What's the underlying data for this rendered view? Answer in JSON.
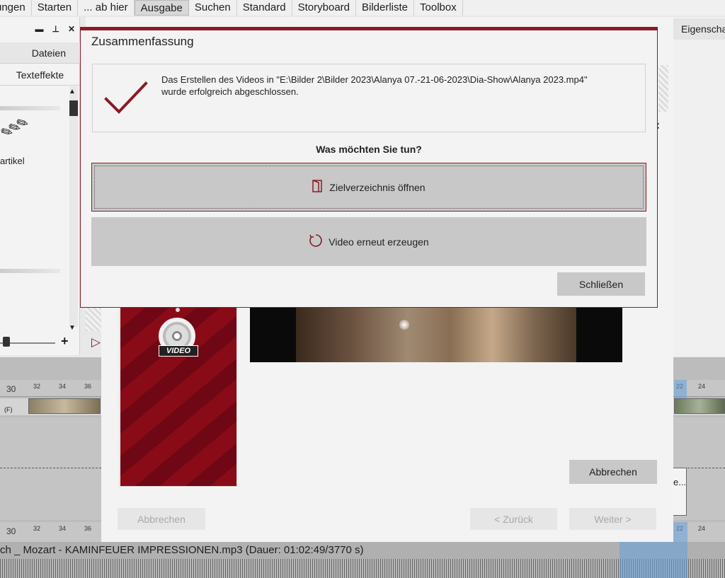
{
  "menu": {
    "items": [
      "ungen",
      "Starten",
      "... ab hier",
      "Ausgabe",
      "Suchen",
      "Standard",
      "Storyboard",
      "Bilderliste",
      "Toolbox"
    ],
    "active_index": 3
  },
  "left_panel": {
    "tab_dateien": "Dateien",
    "tab_texteffekte": "Texteffekte",
    "item_label": "artikel",
    "btn_minimize": "▬",
    "btn_pin": "📌",
    "btn_close": "✕",
    "add_icon": "+"
  },
  "right_panel": {
    "title": "Eigenschaften"
  },
  "timeline": {
    "ruler_top": [
      "30",
      "32",
      "34",
      "36",
      "22",
      "24"
    ],
    "ruler_bottom": [
      "30",
      "32",
      "34",
      "36",
      "22",
      "24"
    ],
    "audio_label": "ch _ Mozart - KAMINFEUER IMPRESSIONEN.mp3 (Dauer: 01:02:49/3770 s)",
    "clip_label": "e...",
    "clip_prefix": "(F)"
  },
  "wizard": {
    "cover_label": "VIDEO",
    "btn_abbrechen_right": "Abbrechen",
    "btn_abbrechen_left": "Abbrechen",
    "btn_zurueck": "< Zurück",
    "btn_weiter": "Weiter >"
  },
  "dialog": {
    "title": "Zusammenfassung",
    "message_line1": "Das Erstellen des Videos in \"E:\\Bilder 2\\Bilder 2023\\Alanya 07.-21-06-2023\\Dia-Show\\Alanya 2023.mp4\"",
    "message_line2": "wurde erfolgreich abgeschlossen.",
    "question": "Was möchten Sie tun?",
    "btn_open_dir": "Zielverzeichnis öffnen",
    "btn_regenerate": "Video erneut erzeugen",
    "btn_close": "Schließen",
    "accent_color": "#8b1a24"
  }
}
